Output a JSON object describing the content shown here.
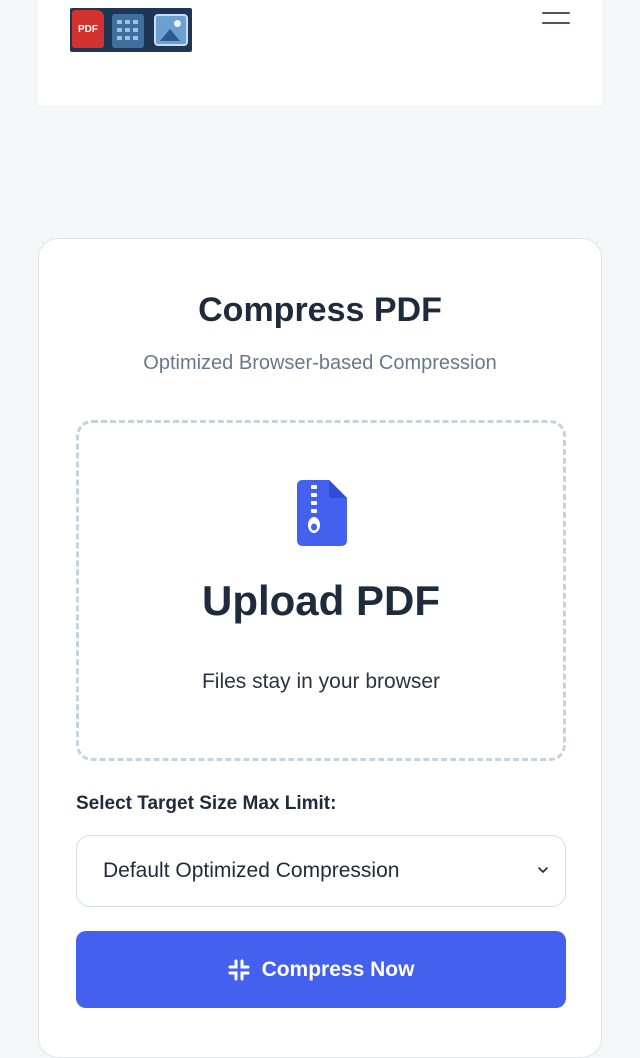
{
  "header": {
    "logo_text": "PDF",
    "menu_icon": "hamburger-menu-icon"
  },
  "card": {
    "title": "Compress PDF",
    "subtitle": "Optimized Browser-based Compression",
    "upload": {
      "icon": "file-zipper-icon",
      "title": "Upload PDF",
      "note": "Files stay in your browser"
    },
    "target_size": {
      "label": "Select Target Size Max Limit:",
      "selected": "Default Optimized Compression"
    },
    "compress_button": {
      "label": "Compress Now",
      "icon": "compress-icon"
    }
  },
  "colors": {
    "accent": "#4361ee",
    "title": "#1e2b3c",
    "muted": "#66788d",
    "page_bg": "#f5f7f9"
  }
}
